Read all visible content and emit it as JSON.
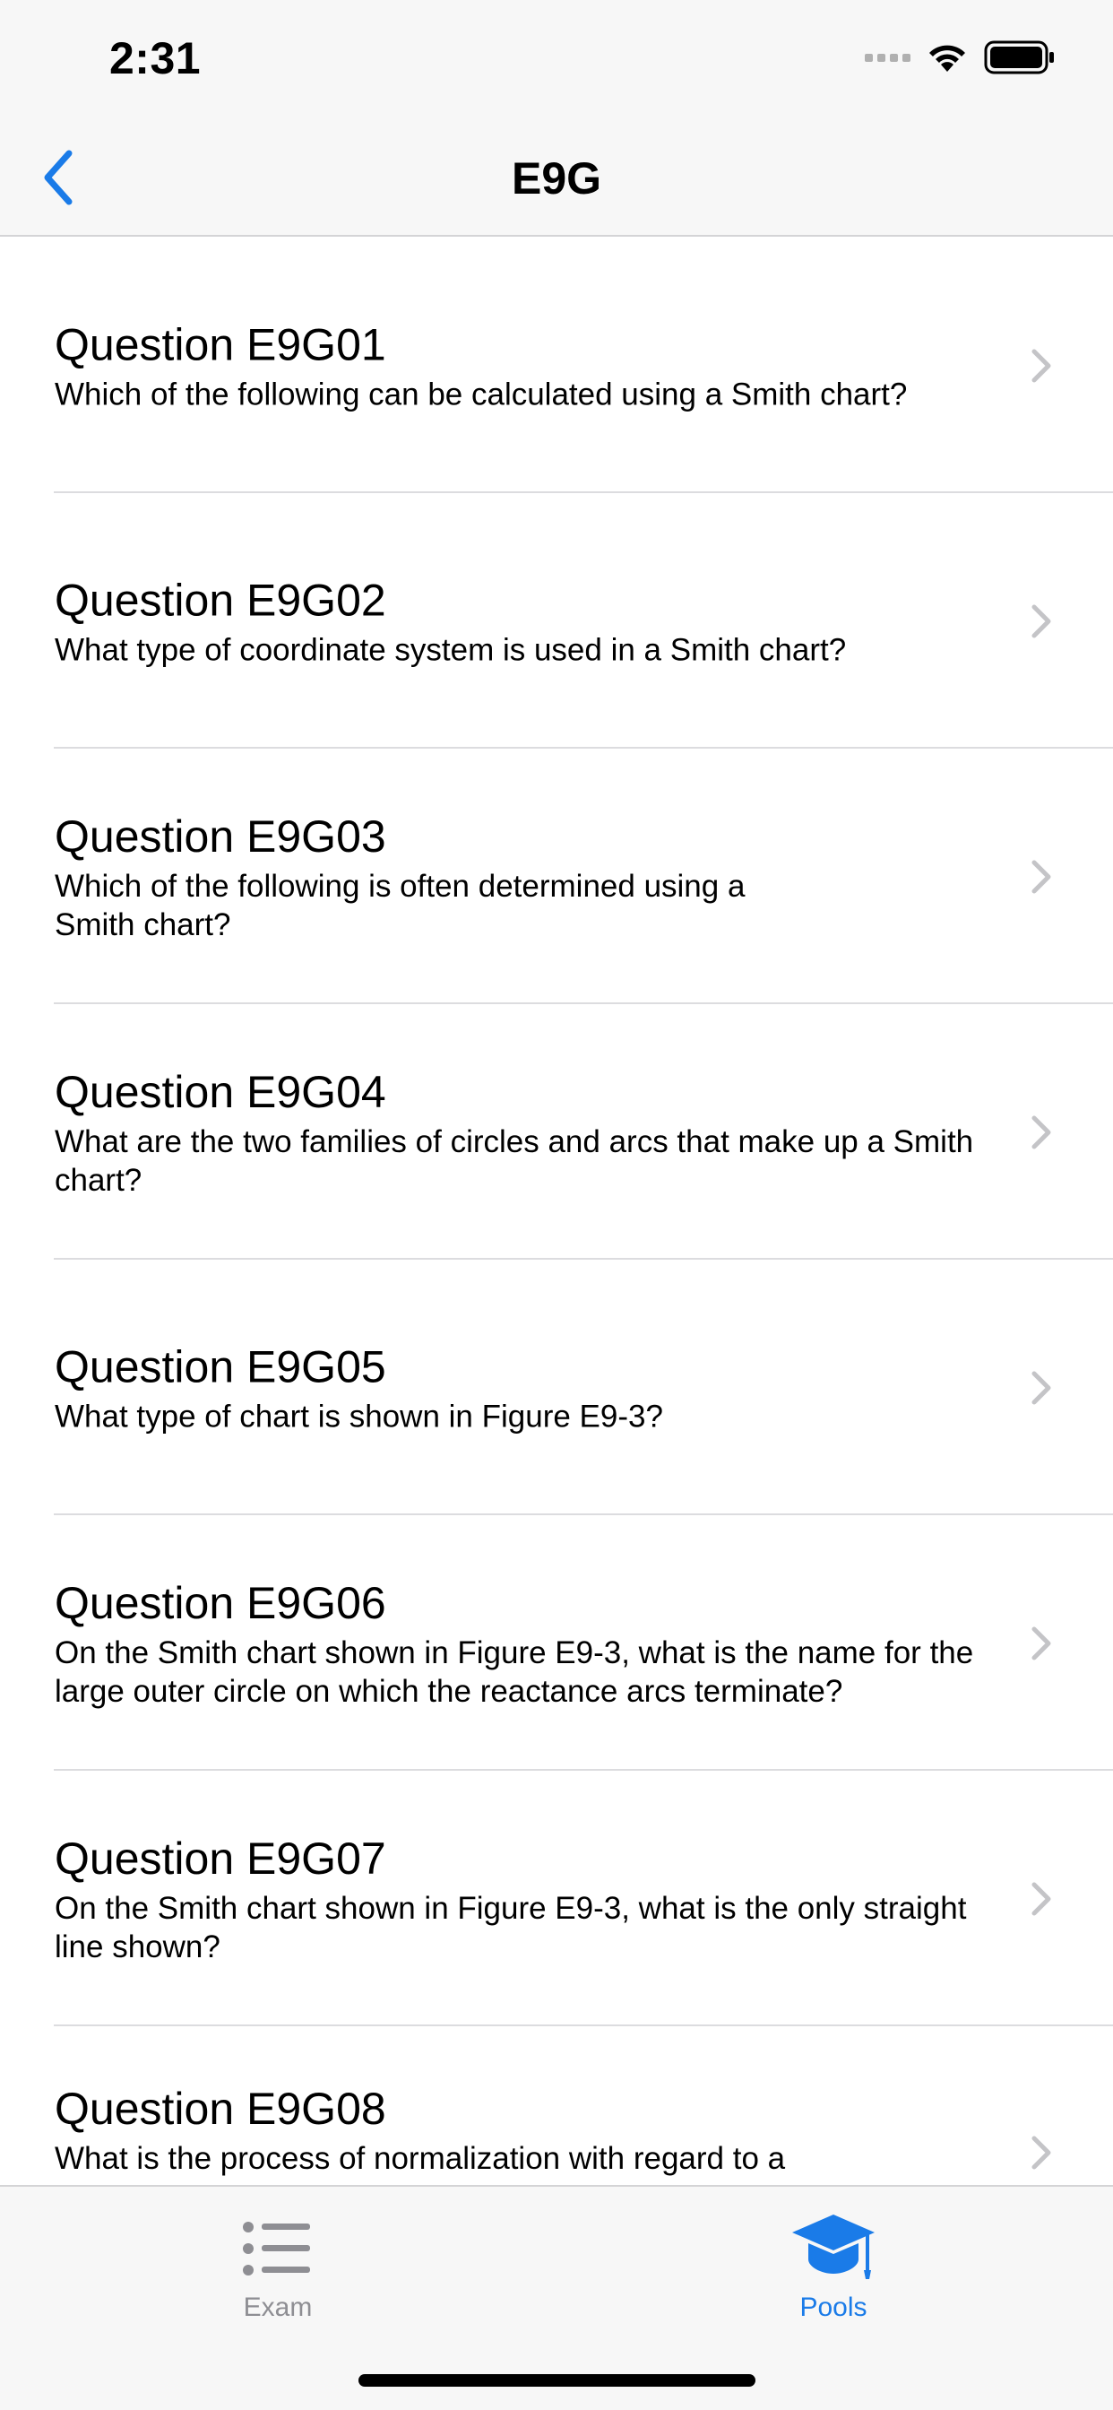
{
  "status_bar": {
    "time": "2:31"
  },
  "nav": {
    "title": "E9G",
    "back_icon": "chevron-left-icon"
  },
  "questions": [
    {
      "title": "Question E9G01",
      "text": "Which of the following can be calculated using a Smith chart?"
    },
    {
      "title": "Question E9G02",
      "text": "What type of coordinate system is used in a Smith chart?"
    },
    {
      "title": "Question E9G03",
      "text": "Which of the following is often determined using a Smith chart?"
    },
    {
      "title": "Question E9G04",
      "text": "What are the two families of circles and arcs that make up a Smith chart?"
    },
    {
      "title": "Question E9G05",
      "text": "What type of chart is shown in Figure E9-3?"
    },
    {
      "title": "Question E9G06",
      "text": "On the Smith chart shown in Figure E9-3, what is the name for the large outer circle on which the reactance arcs terminate?"
    },
    {
      "title": "Question E9G07",
      "text": "On the Smith chart shown in Figure E9-3, what is the only straight line shown?"
    },
    {
      "title": "Question E9G08",
      "text": "What is the process of normalization with regard to a"
    }
  ],
  "tab_bar": {
    "tabs": [
      {
        "label": "Exam",
        "icon": "list-icon",
        "selected": false
      },
      {
        "label": "Pools",
        "icon": "graduation-cap-icon",
        "selected": true
      }
    ]
  },
  "colors": {
    "accent": "#1a7be8",
    "inactive": "#8e8e93",
    "bar_background": "#f7f7f7",
    "separator": "#dcdcdf",
    "chevron": "#c4c4c7"
  }
}
